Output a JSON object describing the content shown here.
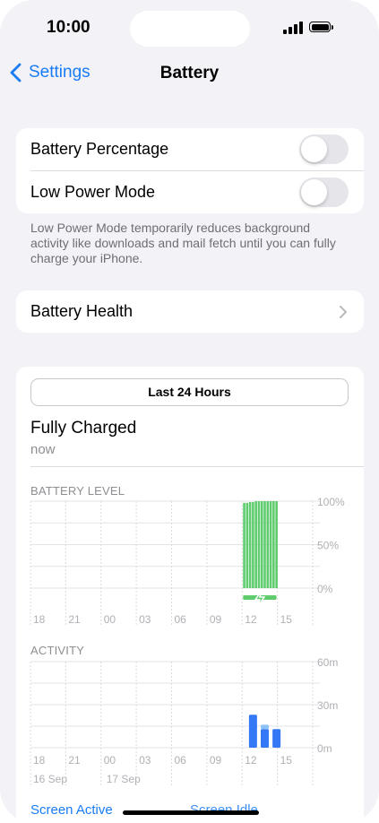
{
  "status_bar": {
    "time": "10:00"
  },
  "nav": {
    "back_label": "Settings",
    "title": "Battery"
  },
  "toggles": {
    "battery_percentage": {
      "label": "Battery Percentage",
      "on": false
    },
    "low_power_mode": {
      "label": "Low Power Mode",
      "on": false
    }
  },
  "low_power_note": "Low Power Mode temporarily reduces background activity like downloads and mail fetch until you can fully charge your iPhone.",
  "battery_health": {
    "label": "Battery Health"
  },
  "usage": {
    "range_button": "Last 24 Hours",
    "status_title": "Fully Charged",
    "status_sub": "now",
    "battery_level_label": "BATTERY LEVEL",
    "activity_label": "ACTIVITY",
    "legend_screen_active": "Screen Active",
    "legend_screen_idle": "Screen Idle"
  },
  "colors": {
    "accent": "#1a7cf5",
    "battery_green": "#5fcc6e",
    "activity_blue": "#3478f6",
    "activity_idle": "#8ec2f7"
  },
  "chart_data": [
    {
      "type": "bar",
      "title": "BATTERY LEVEL",
      "x_ticks": [
        "18",
        "21",
        "00",
        "03",
        "06",
        "09",
        "12",
        "15"
      ],
      "y_ticks": [
        "100%",
        "50%",
        "0%"
      ],
      "ylim": [
        0,
        100
      ],
      "bars": [
        {
          "hour": 12.0,
          "value": 98
        },
        {
          "hour": 12.25,
          "value": 98
        },
        {
          "hour": 12.5,
          "value": 99
        },
        {
          "hour": 12.75,
          "value": 99
        },
        {
          "hour": 13.0,
          "value": 100
        },
        {
          "hour": 13.25,
          "value": 100
        },
        {
          "hour": 13.5,
          "value": 100
        },
        {
          "hour": 13.75,
          "value": 100
        },
        {
          "hour": 14.0,
          "value": 100
        },
        {
          "hour": 14.25,
          "value": 100
        },
        {
          "hour": 14.5,
          "value": 100
        },
        {
          "hour": 14.75,
          "value": 100
        }
      ],
      "charging_span": [
        12.0,
        15.0
      ],
      "charging_icon": "lightning-bolt-icon"
    },
    {
      "type": "bar",
      "title": "ACTIVITY",
      "x_ticks": [
        "18",
        "21",
        "00",
        "03",
        "06",
        "09",
        "12",
        "15"
      ],
      "date_ticks": [
        "16 Sep",
        "17 Sep"
      ],
      "y_ticks": [
        "60m",
        "30m",
        "0m"
      ],
      "ylim": [
        0,
        60
      ],
      "series": [
        {
          "name": "Screen Active",
          "hours": [
            13,
            14,
            15
          ],
          "values": [
            23,
            13,
            13
          ]
        },
        {
          "name": "Screen Idle",
          "hours": [
            13,
            14,
            15
          ],
          "values": [
            0,
            3,
            0
          ]
        }
      ]
    }
  ]
}
